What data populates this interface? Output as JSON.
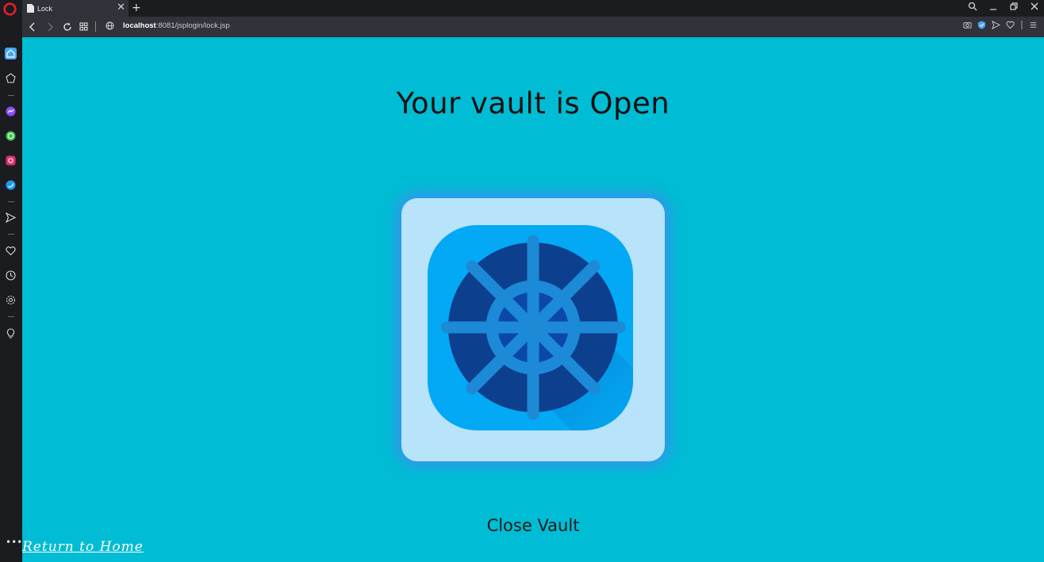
{
  "browser": {
    "tab_title": "Lock",
    "url_host": "localhost",
    "url_path": ":8081/jsplogin/lock.jsp",
    "tab_close_glyph": "✕",
    "new_tab_glyph": "+"
  },
  "page": {
    "heading": "Your vault is Open",
    "close_vault_label": "Close Vault",
    "return_home_label": "Return to Home"
  },
  "colors": {
    "background": "#00bcd4",
    "card": "#b7e3fb",
    "vault_tile": "#03a9f4",
    "vault_door": "#0d3f8f",
    "wheel": "#1c8ad6"
  }
}
